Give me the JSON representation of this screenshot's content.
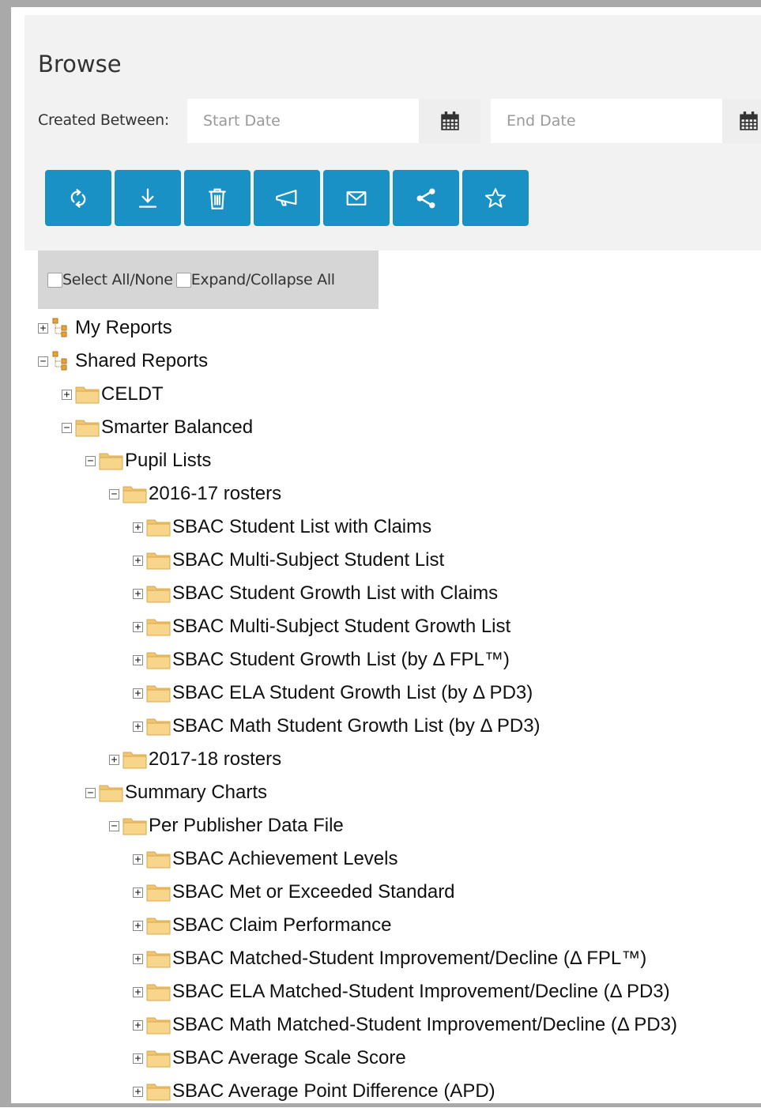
{
  "browse": {
    "title": "Browse"
  },
  "date_filter": {
    "label": "Created Between:",
    "start_placeholder": "Start Date",
    "end_placeholder": "End Date",
    "calendar_icon": "calendar-icon"
  },
  "toolbar": {
    "buttons": [
      {
        "name": "refresh",
        "icon": "refresh-icon"
      },
      {
        "name": "download",
        "icon": "download-icon"
      },
      {
        "name": "delete",
        "icon": "trash-icon"
      },
      {
        "name": "announce",
        "icon": "megaphone-icon"
      },
      {
        "name": "email",
        "icon": "envelope-icon"
      },
      {
        "name": "share",
        "icon": "share-icon"
      },
      {
        "name": "favorite",
        "icon": "star-icon"
      }
    ],
    "accent_color": "#1a91c4"
  },
  "selection": {
    "select_all": "Select All/None",
    "expand_all": "Expand/Collapse All"
  },
  "tree": {
    "nodes": [
      {
        "label": "My Reports",
        "level": 0,
        "expanded": false,
        "kind": "root"
      },
      {
        "label": "Shared Reports",
        "level": 0,
        "expanded": true,
        "kind": "root"
      },
      {
        "label": "CELDT",
        "level": 1,
        "expanded": false,
        "kind": "folder"
      },
      {
        "label": "Smarter Balanced",
        "level": 1,
        "expanded": true,
        "kind": "folder"
      },
      {
        "label": "Pupil Lists",
        "level": 2,
        "expanded": true,
        "kind": "folder"
      },
      {
        "label": "2016-17 rosters",
        "level": 3,
        "expanded": true,
        "kind": "folder"
      },
      {
        "label": "SBAC Student List with Claims",
        "level": 4,
        "expanded": false,
        "kind": "folder"
      },
      {
        "label": "SBAC Multi-Subject Student List",
        "level": 4,
        "expanded": false,
        "kind": "folder"
      },
      {
        "label": "SBAC Student Growth List with Claims",
        "level": 4,
        "expanded": false,
        "kind": "folder"
      },
      {
        "label": "SBAC Multi-Subject Student Growth List",
        "level": 4,
        "expanded": false,
        "kind": "folder"
      },
      {
        "label": "SBAC Student Growth List (by Δ FPL™)",
        "level": 4,
        "expanded": false,
        "kind": "folder"
      },
      {
        "label": "SBAC ELA Student Growth List (by Δ PD3)",
        "level": 4,
        "expanded": false,
        "kind": "folder"
      },
      {
        "label": "SBAC Math Student Growth List (by Δ PD3)",
        "level": 4,
        "expanded": false,
        "kind": "folder"
      },
      {
        "label": "2017-18 rosters",
        "level": 3,
        "expanded": false,
        "kind": "folder"
      },
      {
        "label": "Summary Charts",
        "level": 2,
        "expanded": true,
        "kind": "folder"
      },
      {
        "label": "Per Publisher Data File",
        "level": 3,
        "expanded": true,
        "kind": "folder"
      },
      {
        "label": "SBAC Achievement Levels",
        "level": 4,
        "expanded": false,
        "kind": "folder"
      },
      {
        "label": "SBAC Met or Exceeded Standard",
        "level": 4,
        "expanded": false,
        "kind": "folder"
      },
      {
        "label": "SBAC Claim Performance",
        "level": 4,
        "expanded": false,
        "kind": "folder"
      },
      {
        "label": "SBAC Matched-Student Improvement/Decline (Δ FPL™)",
        "level": 4,
        "expanded": false,
        "kind": "folder"
      },
      {
        "label": "SBAC ELA Matched-Student Improvement/Decline (Δ PD3)",
        "level": 4,
        "expanded": false,
        "kind": "folder"
      },
      {
        "label": "SBAC Math Matched-Student Improvement/Decline (Δ PD3)",
        "level": 4,
        "expanded": false,
        "kind": "folder"
      },
      {
        "label": "SBAC Average Scale Score",
        "level": 4,
        "expanded": false,
        "kind": "folder"
      },
      {
        "label": "SBAC Average Point Difference (APD)",
        "level": 4,
        "expanded": false,
        "kind": "folder"
      }
    ]
  }
}
